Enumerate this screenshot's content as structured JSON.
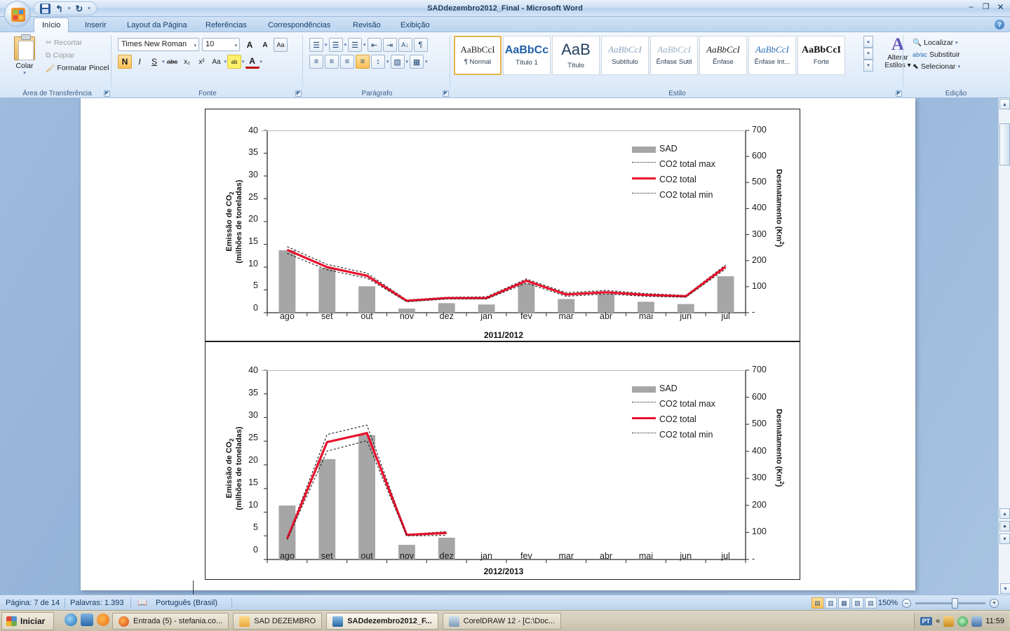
{
  "window": {
    "title": "SADdezembro2012_Final - Microsoft Word",
    "minimize": "–",
    "maximize": "❐",
    "close": "✕",
    "help": "?"
  },
  "quick_access": {
    "save": "save-icon",
    "undo": "↰",
    "redo": "↻",
    "more": "▾"
  },
  "tabs": [
    {
      "label": "Início",
      "active": true
    },
    {
      "label": "Inserir",
      "active": false
    },
    {
      "label": "Layout da Página",
      "active": false
    },
    {
      "label": "Referências",
      "active": false
    },
    {
      "label": "Correspondências",
      "active": false
    },
    {
      "label": "Revisão",
      "active": false
    },
    {
      "label": "Exibição",
      "active": false
    }
  ],
  "ribbon": {
    "clipboard": {
      "group_label": "Área de Transferência",
      "paste": "Colar",
      "cut": "Recortar",
      "copy": "Copiar",
      "format_painter": "Formatar Pincel"
    },
    "font": {
      "group_label": "Fonte",
      "font_name": "Times New Roman",
      "font_size": "10",
      "grow": "A",
      "shrink": "A",
      "clear_format": "Aa",
      "bold": "N",
      "italic": "I",
      "underline": "S",
      "strikethrough": "abc",
      "subscript": "x₂",
      "superscript": "x²",
      "change_case": "Aa",
      "highlight": "ab",
      "font_color": "A"
    },
    "paragraph": {
      "group_label": "Parágrafo",
      "bullets": "☰",
      "numbering": "☰",
      "multilevel": "☰",
      "decrease_indent": "⇤",
      "increase_indent": "⇥",
      "sort": "A↓",
      "show_marks": "¶",
      "align_left": "≡",
      "align_center": "≡",
      "align_right": "≡",
      "justify": "≡",
      "line_spacing": "↕",
      "shading": "▧",
      "borders": "▦"
    },
    "styles": {
      "group_label": "Estilo",
      "items": [
        {
          "preview": "AaBbCcI",
          "name": "¶ Normal",
          "selected": true
        },
        {
          "preview": "AaBbCc",
          "name": "Título 1",
          "selected": false
        },
        {
          "preview": "AaB",
          "name": "Título",
          "selected": false
        },
        {
          "preview": "AaBbCcI",
          "name": "Subtítulo",
          "selected": false
        },
        {
          "preview": "AaBbCcI",
          "name": "Ênfase Sutil",
          "selected": false
        },
        {
          "preview": "AaBbCcI",
          "name": "Ênfase",
          "selected": false
        },
        {
          "preview": "AaBbCcI",
          "name": "Ênfase Int...",
          "selected": false
        },
        {
          "preview": "AaBbCcI",
          "name": "Forte",
          "selected": false
        }
      ],
      "change_styles_line1": "Alterar",
      "change_styles_line2": "Estilos "
    },
    "editing": {
      "group_label": "Edição",
      "find": "Localizar",
      "replace": "Substituir",
      "select": "Selecionar"
    }
  },
  "status_bar": {
    "page": "Página: 7 de 14",
    "words": "Palavras: 1.393",
    "language": "Português (Brasil)",
    "zoom": "150%",
    "zoom_out": "–",
    "zoom_in": "+",
    "views": [
      "print-layout-icon",
      "full-screen-reading-icon",
      "web-layout-icon",
      "outline-icon",
      "draft-icon"
    ]
  },
  "taskbar": {
    "start": "Iniciar",
    "quick_launch": [
      "internet-explorer-icon",
      "outlook-icon",
      "media-player-icon"
    ],
    "buttons": [
      {
        "icon": "firefox-icon",
        "label": "Entrada (5) - stefania.co...",
        "active": false
      },
      {
        "icon": "folder-icon",
        "label": "SAD DEZEMBRO",
        "active": false
      },
      {
        "icon": "word-icon",
        "label": "SADdezembro2012_F...",
        "active": true
      },
      {
        "icon": "coreldraw-icon",
        "label": "CorelDRAW 12 - [C:\\Doc...",
        "active": false
      }
    ],
    "tray": {
      "lang": "PT",
      "chevron": "«",
      "icons": [
        "java-icon",
        "disc-icon",
        "network-icon"
      ],
      "clock": "11:59"
    }
  },
  "chart_data": [
    {
      "type": "bar",
      "id": "chart-2011-2012",
      "title": "",
      "xlabel": "2011/2012",
      "ylabel": "Emissão de CO₂\n(milhões de toneladas)",
      "ylabel_line1": "Emissão de CO",
      "ylabel_sub": "2",
      "ylabel_line2": "(milhões de toneladas)",
      "y2label_part1": "Desmatamento (Km",
      "y2label_sup": "2",
      "y2label_part3": ")",
      "categories": [
        "ago",
        "set",
        "out",
        "nov",
        "dez",
        "jan",
        "fev",
        "mar",
        "abr",
        "mai",
        "jun",
        "jul"
      ],
      "ylim": [
        0,
        40
      ],
      "yticks": [
        0,
        5,
        10,
        15,
        20,
        25,
        30,
        35,
        40
      ],
      "y2lim": [
        0,
        700
      ],
      "y2ticks": [
        "-",
        "100",
        "200",
        "300",
        "400",
        "500",
        "600",
        "700"
      ],
      "grid": false,
      "legend_position": "top-right",
      "series": [
        {
          "name": "SAD",
          "kind": "bar",
          "color": "#a6a6a6",
          "values": [
            13.7,
            9.8,
            5.8,
            0.9,
            2.1,
            1.8,
            6.4,
            3.0,
            4.1,
            2.4,
            1.9,
            8.0
          ]
        },
        {
          "name": "CO2 total max",
          "kind": "dashed",
          "color": "#222222",
          "values": [
            14.5,
            10.6,
            8.7,
            2.8,
            3.4,
            3.5,
            7.4,
            4.4,
            4.9,
            4.2,
            3.8,
            10.5
          ]
        },
        {
          "name": "CO2 total",
          "kind": "solid",
          "color": "#e8112d",
          "values": [
            13.8,
            10.0,
            8.1,
            2.6,
            3.2,
            3.2,
            7.0,
            4.0,
            4.5,
            3.9,
            3.6,
            10.1
          ]
        },
        {
          "name": "CO2 total min",
          "kind": "dashed",
          "color": "#222222",
          "values": [
            13.0,
            9.4,
            7.6,
            2.4,
            3.0,
            3.0,
            6.5,
            3.6,
            4.1,
            3.6,
            3.4,
            9.6
          ]
        }
      ]
    },
    {
      "type": "bar",
      "id": "chart-2012-2013",
      "title": "",
      "xlabel": "2012/2013",
      "ylabel_line1": "Emissão de CO",
      "ylabel_sub": "2",
      "ylabel_line2": "(milhões de toneladas)",
      "y2label_part1": "Desmatamento (Km",
      "y2label_sup": "2",
      "y2label_part3": ")",
      "categories": [
        "ago",
        "set",
        "out",
        "nov",
        "dez",
        "jan",
        "fev",
        "mar",
        "abr",
        "mai",
        "jun",
        "jul"
      ],
      "ylim": [
        0,
        40
      ],
      "yticks": [
        0,
        5,
        10,
        15,
        20,
        25,
        30,
        35,
        40
      ],
      "y2lim": [
        0,
        700
      ],
      "y2ticks": [
        "-",
        "100",
        "200",
        "300",
        "400",
        "500",
        "600",
        "700"
      ],
      "grid": false,
      "legend_position": "top-right",
      "series": [
        {
          "name": "SAD",
          "kind": "bar",
          "color": "#a6a6a6",
          "values": [
            11.4,
            21.2,
            26.3,
            3.1,
            4.6,
            null,
            null,
            null,
            null,
            null,
            null,
            null
          ]
        },
        {
          "name": "CO2 total max",
          "kind": "dashed",
          "color": "#222222",
          "values": [
            4.6,
            26.4,
            28.4,
            5.3,
            5.9,
            null,
            null,
            null,
            null,
            null,
            null,
            null
          ]
        },
        {
          "name": "CO2 total",
          "kind": "solid",
          "color": "#e8112d",
          "values": [
            4.4,
            24.8,
            26.7,
            5.2,
            5.6,
            null,
            null,
            null,
            null,
            null,
            null,
            null
          ]
        },
        {
          "name": "CO2 total min",
          "kind": "dashed",
          "color": "#222222",
          "values": [
            4.2,
            22.9,
            25.1,
            5.0,
            5.1,
            null,
            null,
            null,
            null,
            null,
            null,
            null
          ]
        }
      ]
    }
  ]
}
